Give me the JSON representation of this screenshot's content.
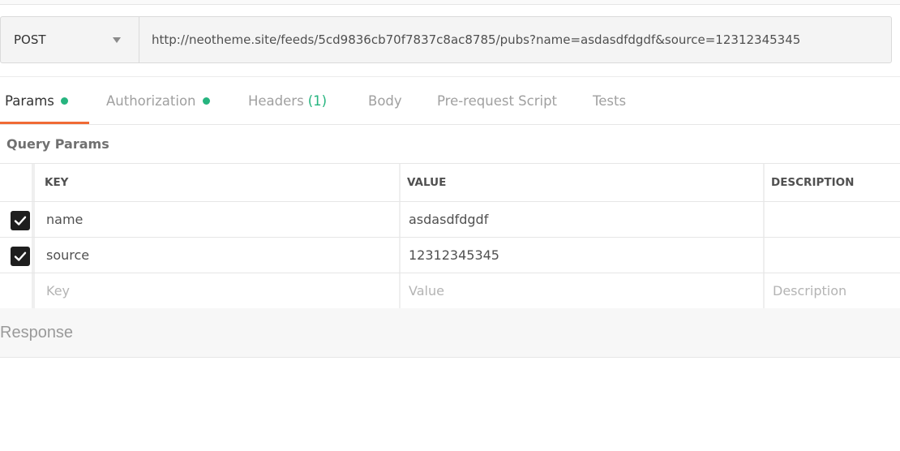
{
  "request": {
    "method": "POST",
    "url": "http://neotheme.site/feeds/5cd9836cb70f7837c8ac8785/pubs?name=asdasdfdgdf&source=12312345345"
  },
  "tabs": [
    {
      "label": "Params",
      "active": true,
      "indicator": "green-dot"
    },
    {
      "label": "Authorization",
      "active": false,
      "indicator": "green-dot"
    },
    {
      "label": "Headers",
      "count": "(1)",
      "active": false
    },
    {
      "label": "Body",
      "active": false
    },
    {
      "label": "Pre-request Script",
      "active": false
    },
    {
      "label": "Tests",
      "active": false
    }
  ],
  "colors": {
    "accent": "#f06a35",
    "success": "#26b47f"
  },
  "query_params": {
    "title": "Query Params",
    "columns": [
      "KEY",
      "VALUE",
      "DESCRIPTION"
    ],
    "rows": [
      {
        "checked": true,
        "key": "name",
        "value": "asdasdfdgdf",
        "description": ""
      },
      {
        "checked": true,
        "key": "source",
        "value": "12312345345",
        "description": ""
      }
    ],
    "placeholders": {
      "key": "Key",
      "value": "Value",
      "description": "Description"
    }
  },
  "response": {
    "label": "Response"
  }
}
